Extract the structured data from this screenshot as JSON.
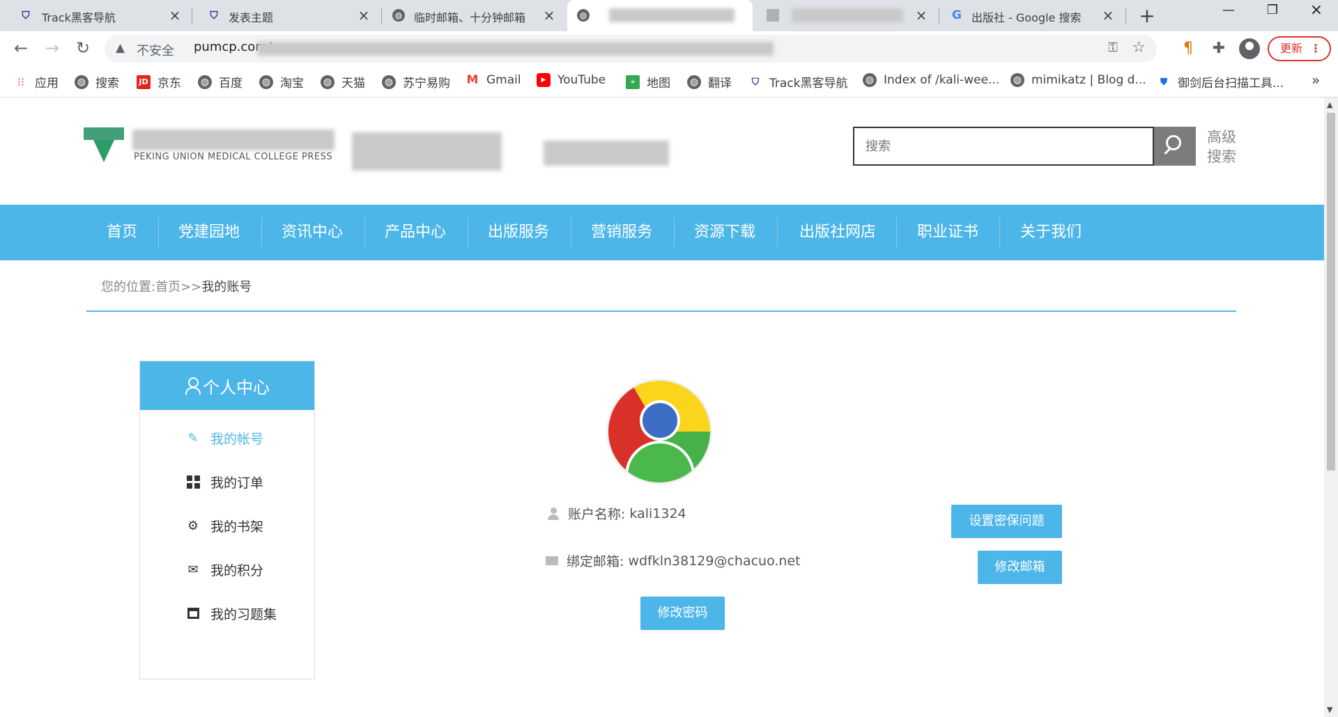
{
  "browser": {
    "tabs": [
      {
        "label": "Track黑客导航",
        "icon": "track-favicon-icon"
      },
      {
        "label": "发表主题",
        "icon": "track-favicon-icon"
      },
      {
        "label": "临时邮箱、十分钟邮箱",
        "icon": "globe-icon"
      },
      {
        "label": "",
        "icon": "globe-icon"
      },
      {
        "label": "",
        "icon": "generic-favicon-icon"
      },
      {
        "label": "出版社 - Google 搜索",
        "icon": "google-icon"
      }
    ],
    "address": {
      "security_label": "不安全",
      "url": "pumcp.com/"
    },
    "update_label": "更新",
    "bookmarks": [
      {
        "label": "应用",
        "icon": "apps-grid-icon"
      },
      {
        "label": "搜索",
        "icon": "globe-icon"
      },
      {
        "label": "京东",
        "icon": "jd-icon"
      },
      {
        "label": "百度",
        "icon": "globe-icon"
      },
      {
        "label": "淘宝",
        "icon": "globe-icon"
      },
      {
        "label": "天猫",
        "icon": "globe-icon"
      },
      {
        "label": "苏宁易购",
        "icon": "globe-icon"
      },
      {
        "label": "Gmail",
        "icon": "gmail-icon"
      },
      {
        "label": "YouTube",
        "icon": "youtube-icon"
      },
      {
        "label": "地图",
        "icon": "maps-icon"
      },
      {
        "label": "翻译",
        "icon": "globe-icon"
      },
      {
        "label": "Track黑客导航",
        "icon": "track-favicon-icon"
      },
      {
        "label": "Index of /kali-wee...",
        "icon": "globe-icon"
      },
      {
        "label": "mimikatz | Blog d...",
        "icon": "globe-icon"
      },
      {
        "label": "御剑后台扫描工具...",
        "icon": "shield-icon"
      }
    ],
    "more_label": "»"
  },
  "site": {
    "logo_subtitle": "PEKING UNION MEDICAL COLLEGE PRESS",
    "search_placeholder": "搜索",
    "advanced_search_label": "高级搜索",
    "nav": [
      "首页",
      "党建园地",
      "资讯中心",
      "产品中心",
      "出版服务",
      "营销服务",
      "资源下载",
      "出版社网店",
      "职业证书",
      "关于我们"
    ],
    "breadcrumb": {
      "prefix": "您的位置:",
      "home": "首页",
      "sep": ">>",
      "current": "我的账号"
    }
  },
  "sidebar": {
    "title": "个人中心",
    "items": [
      {
        "label": "我的帐号",
        "icon": "pencil-icon",
        "active": true
      },
      {
        "label": "我的订单",
        "icon": "grid-icon",
        "active": false
      },
      {
        "label": "我的书架",
        "icon": "gear-icon",
        "active": false
      },
      {
        "label": "我的积分",
        "icon": "envelope-icon",
        "active": false
      },
      {
        "label": "我的习题集",
        "icon": "calendar-icon",
        "active": false
      }
    ]
  },
  "account": {
    "username_label": "账户名称:",
    "username": "kali1324",
    "email_label": "绑定邮箱:",
    "email": "wdfkln38129@chacuo.net",
    "buttons": {
      "security_question": "设置密保问题",
      "change_email": "修改邮箱",
      "change_password": "修改密码"
    }
  },
  "colors": {
    "accent": "#4db6e9",
    "browser_frame": "#dee1e6",
    "update_red": "#d93025"
  }
}
